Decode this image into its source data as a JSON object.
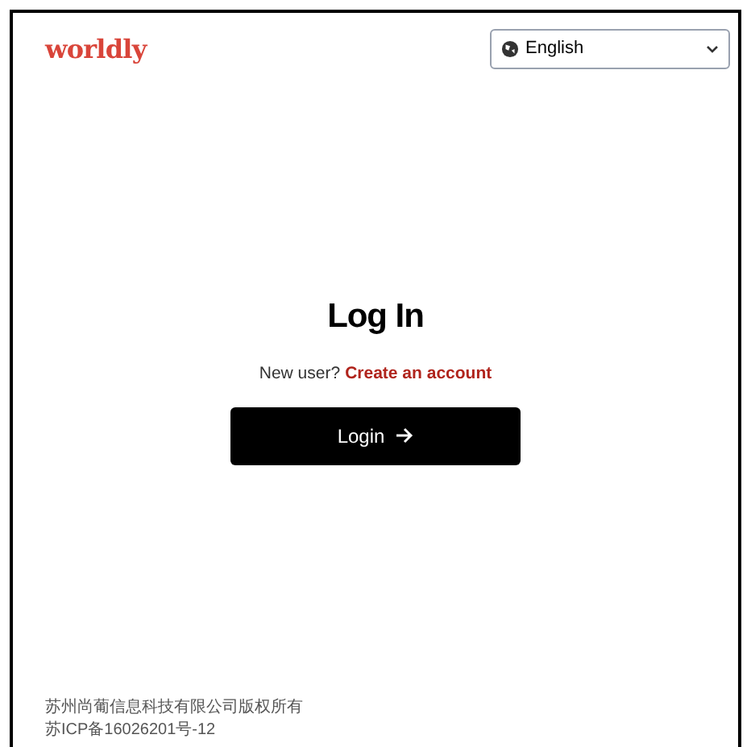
{
  "header": {
    "logo": "worldly",
    "language_select": {
      "value": "English"
    }
  },
  "login": {
    "title": "Log In",
    "prompt": "New user?",
    "signup_link": "Create an account",
    "button": "Login"
  },
  "footer": {
    "lines": [
      "苏州尚葡信息科技有限公司版权所有",
      "苏ICP备16026201号-12"
    ]
  }
}
